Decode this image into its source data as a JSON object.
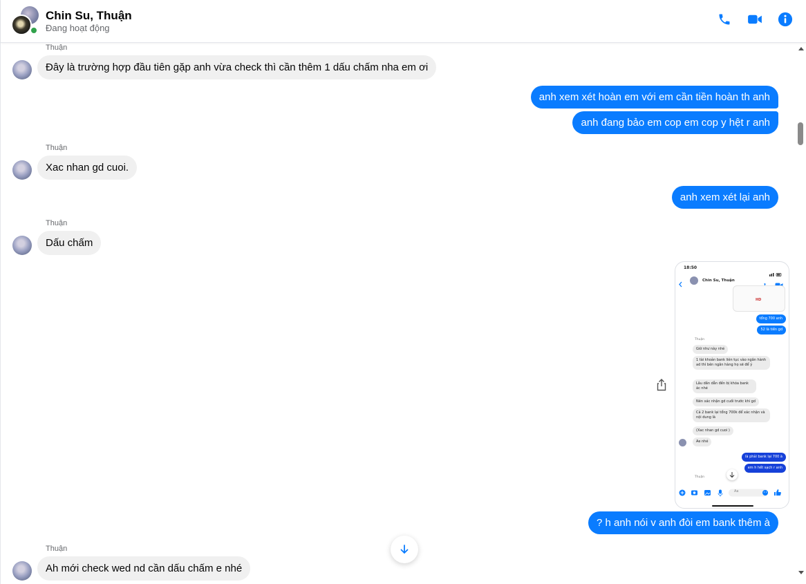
{
  "colors": {
    "accent": "#0a7cff",
    "incoming_bubble": "#f0f0f0",
    "online": "#31a24c"
  },
  "header": {
    "name": "Chin Su, Thuận",
    "status": "Đang hoạt động",
    "icons": [
      "phone-icon",
      "video-icon",
      "info-icon"
    ]
  },
  "messages": [
    {
      "sender": "Thuận",
      "text": "Đây là trường hợp đầu tiên gặp anh vừa check thì cần thêm 1 dấu chấm nha em ơi"
    },
    {
      "text": "anh xem xét hoàn em với em cần tiền hoàn th anh"
    },
    {
      "text": "anh đang bảo em cop em cop y hệt r anh"
    },
    {
      "sender": "Thuận",
      "text": "Xac nhan gd cuoi."
    },
    {
      "text": "anh xem xét lại anh"
    },
    {
      "sender": "Thuận",
      "text": "Dấu chấm"
    },
    {
      "text": "? h anh nói v anh đòi em bank thêm à"
    },
    {
      "sender": "Thuận",
      "text": "Ah mới check wed nd cần dấu chấm e nhé"
    }
  ],
  "shared_image": {
    "time": "18:50",
    "title": "Chin Su, Thuận",
    "badge": "HD",
    "out_msgs": [
      "tổng 700 anh",
      "52 là tiền gd"
    ],
    "sender": "Thuận",
    "in_msgs": [
      "Giờ như này nhé",
      "1 tài khoản bank liên tục vào ngân hành ad thì bên ngân hàng họ sẽ để ý",
      "Lâu dần dẫn đến bị khóa bank ác nhé",
      "Nên xác nhận gd cuối trước khi gd",
      "Cả 2 bank lại tổng 700k để xác nhận và nội dung là",
      "(Xac nhan gd cuoi )",
      "Ae nhé"
    ],
    "out_msgs2": [
      "là phải bank lại 700 à",
      "em h hết sạch r anh"
    ],
    "input_placeholder": "Aa"
  }
}
